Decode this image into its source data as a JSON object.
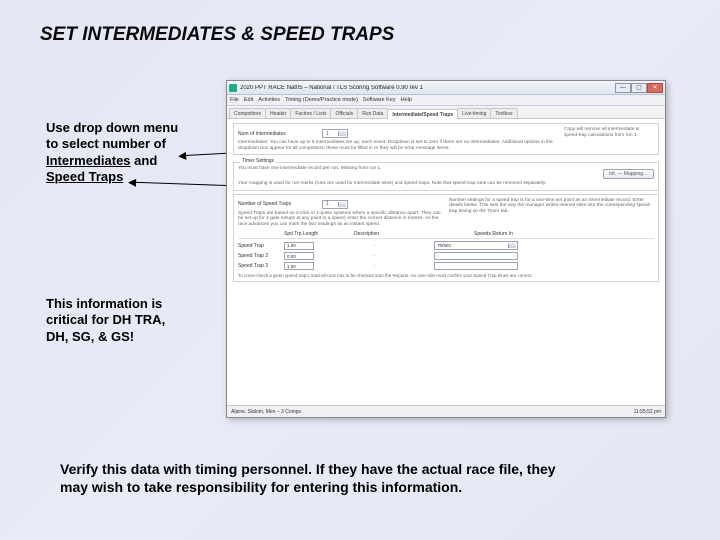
{
  "slide": {
    "title": "SET INTERMEDIATES & SPEED TRAPS",
    "callout1_l1": "Use drop down menu",
    "callout1_l2": "to select number of",
    "callout1_l3a": "Intermediates",
    "callout1_l3b": " and ",
    "callout1_l4": "Speed Traps",
    "callout2_l1": "This information is",
    "callout2_l2": "critical for DH TRA,",
    "callout2_l3": "DH, SG, & GS!",
    "bottom_l1": "Verify this data with timing personnel.  If they have the actual race file, they",
    "bottom_l2": "may wish to take responsibility for entering this information."
  },
  "app": {
    "title": "2020 PPT RACE Nat05 – National / TLS Scoring Software 0.90 rev 1",
    "menu": [
      "File",
      "Edit",
      "Activities",
      "Timing (Demo/Practice mode)",
      "Software Key",
      "Help"
    ],
    "tabs": [
      "Competitors",
      "Header",
      "Factors / Lists",
      "Officials",
      "Run Data",
      "Intermediate/Speed Traps",
      "Live-timing",
      "Toolbox"
    ],
    "activeTab": 5,
    "panel_intro": "Intermediates: You can have up to 5 intermediates set up, each event. Dropdown is set to zero if there are no intermediates. Additional options in the dropdown box appear for all competitors; these must be filled in or they will be error message items.",
    "panel_intro_right": "Copy will remove all intermediate & speed-trap calculations from run 1.",
    "row_int_label": "You must have one intermediate record per run. Missing from run 1.",
    "row_int_btn": "Int. — Mapping…",
    "row_int_hint": "Your mapping is used for run marks (runs are used for intermediate sites) and speed traps. Note that speed-trap runs can be removed separately.",
    "legend": "Timer Settings",
    "num_label": "Number of Speed Traps",
    "num_value": "1",
    "num_hint": "Number settings for a speed trap is for a one-time set point as an intermediate record. Enter details below. This sets the way the manager writes interval sites into the corresponding speed-trap timing on the Timer tab.",
    "speed_desc": "Speed Traps are based on 2-click or 1-pulse systems where a specific distance apart. They can be set up for 1-gate setups at any point in a speed; enter the correct distance in metres. As the race advances you can mark the two readings as an instant speed.",
    "grid": {
      "headers": [
        "",
        "Spd Trp Length",
        "Description",
        "Speeds Return In"
      ],
      "rows": [
        {
          "label": "Speed Trap",
          "val": "1.00",
          "unit": "m/sec"
        },
        {
          "label": "Speed Trap 2",
          "val": "0.00",
          "unit": ""
        },
        {
          "label": "Speed Trap 3",
          "val": "1.00",
          "unit": ""
        }
      ]
    },
    "grid_note": "To cross-check a given speed trap's read-all-runs has to be checked onto the Reports. An over-ride must confirm your Speed Trap times are correct.",
    "status_left": "Alpine, Slalom, Men – 3 Comps",
    "status_right": "11:55:52 pm"
  }
}
